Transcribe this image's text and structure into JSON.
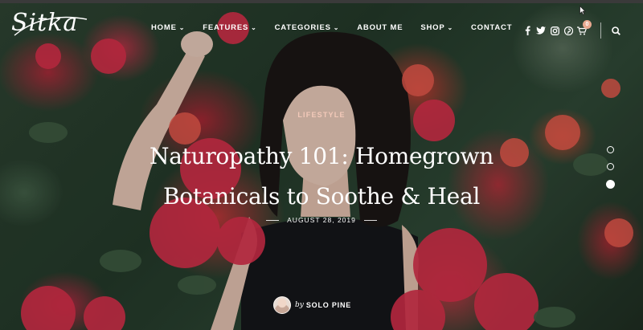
{
  "brand": {
    "logo_text": "Sitka"
  },
  "nav": {
    "items": [
      {
        "label": "HOME",
        "has_dropdown": true
      },
      {
        "label": "FEATURES",
        "has_dropdown": true
      },
      {
        "label": "CATEGORIES",
        "has_dropdown": true
      },
      {
        "label": "ABOUT ME",
        "has_dropdown": false
      },
      {
        "label": "SHOP",
        "has_dropdown": true
      },
      {
        "label": "CONTACT",
        "has_dropdown": false
      }
    ],
    "dropdown_glyph": "⌄"
  },
  "header_icons": {
    "social": [
      "facebook-icon",
      "twitter-icon",
      "instagram-icon",
      "pinterest-icon"
    ],
    "cart_icon": "cart-icon",
    "cart_count": "0",
    "search_icon": "search-icon"
  },
  "hero": {
    "category": "LIFESTYLE",
    "title": "Naturopathy 101: Homegrown Botanicals to Soothe & Heal",
    "date": "AUGUST 28, 2019",
    "author_prefix": "by",
    "author_name": "SOLO PINE"
  },
  "slider": {
    "total": 3,
    "active_index": 3
  },
  "colors": {
    "category": "#f3c9b9",
    "cart_badge": "#e8a88f",
    "text": "#ffffff"
  }
}
